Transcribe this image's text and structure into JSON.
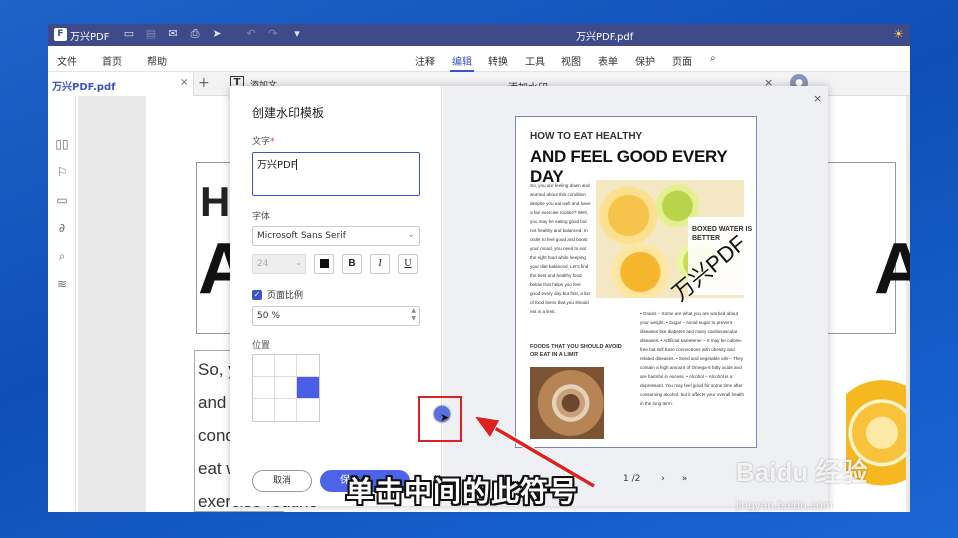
{
  "titlebar": {
    "logo": "F",
    "app_name": "万兴PDF",
    "doc_title": "万兴PDF.pdf",
    "icons": [
      "folder-icon",
      "save-icon",
      "mail-icon",
      "print-icon",
      "share-icon",
      "undo-icon",
      "redo-icon",
      "quick-access-icon",
      "theme-icon"
    ]
  },
  "menubar": {
    "file": "文件",
    "home": "首页",
    "help": "帮助",
    "annotate": "注释",
    "edit": "编辑",
    "convert": "转换",
    "tools": "工具",
    "view": "视图",
    "form": "表单",
    "protect": "保护",
    "page": "页面"
  },
  "tab": {
    "label": "万兴PDF.pdf",
    "close": "×",
    "add": "+"
  },
  "document": {
    "heading_small": "HOW",
    "heading_large": "AN",
    "heading_tail": "AY",
    "lines": [
      "So, you ar",
      "and worri",
      "condition",
      "eat well a",
      "exercise routine"
    ]
  },
  "add_watermark_bar": {
    "icon_letter": "T",
    "add_text": "添加文",
    "title": "添加水印",
    "close": "×"
  },
  "form": {
    "title": "创建水印模板",
    "text_label": "文字",
    "required_mark": "*",
    "text_value": "万兴PDF",
    "font_label": "字体",
    "font_value": "Microsoft Sans Serif",
    "font_size": "24",
    "bold": "B",
    "italic": "I",
    "underline": "U",
    "page_ratio_label": "页面比例",
    "page_ratio_value": "50 %",
    "position_label": "位置",
    "cancel": "取消",
    "save": "保"
  },
  "preview": {
    "close": "×",
    "h1": "HOW TO EAT HEALTHY",
    "h2": "AND FEEL GOOD EVERY DAY",
    "col1": "So, you are feeling down and worried about this condition despite you eat well and have a fair exercise routine? Well, you may be eating good but not healthy and balanced. In order to feel good and boost your mood, you need to eat the right food while keeping your diet balanced. Let's find the best and healthy food below that helps you feel good every day but first, a list of food items that you should eat in a limit.",
    "bottle_text": "BOXED WATER IS BETTER",
    "sub_heading": "FOODS THAT YOU SHOULD AVOID OR EAT IN A LIMIT",
    "col2": "• Grains – Some are what you are worried about your weight. • Sugar – Avoid sugar to prevent diseases like diabetes and many cardiovascular diseases. • Artificial sweetener – It may be calorie-free but still have connections with obesity and related diseases. • Seed and vegetable oils – They contain a high amount of Omega-6 fatty acids and are harmful in excess. • Alcohol – Alcohol is a depressant. You may feel good for some time after consuming alcohol, but it affects your overall health in the long term.",
    "watermark": "万兴PDF",
    "pager": "1 /2",
    "next": "›",
    "last": "»"
  },
  "caption": "单击中间的此符号",
  "watermark_site": {
    "logo": "Baidu 经验",
    "url": "jingyan.baidu.com"
  },
  "colors": {
    "accent": "#3b54c6",
    "titlebar": "#3e4a8a",
    "selected_cell": "#4a5ee8",
    "annotation": "#e02020"
  }
}
